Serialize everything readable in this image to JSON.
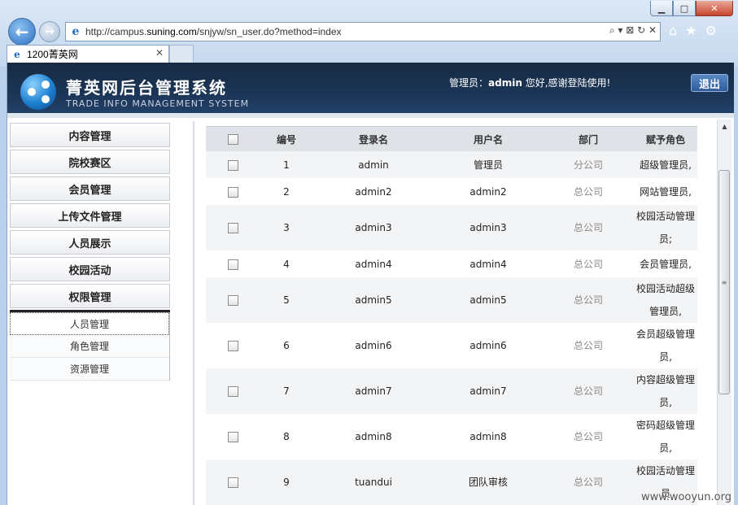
{
  "browser": {
    "url_prefix": "http://campus.",
    "url_domain": "suning.com",
    "url_suffix": "/snjyw/sn_user.do?method=index",
    "tab_title": "1200菁英网",
    "addr_tools": "⌕ ▾ ⊠ ↻ ✕"
  },
  "header": {
    "title_cn": "菁英网后台管理系统",
    "title_en": "TRADE INFO MANAGEMENT SYSTEM",
    "welcome_prefix": "管理员：",
    "welcome_user": "admin",
    "welcome_suffix": " 您好,感谢登陆使用!",
    "logout_label": "退出"
  },
  "sidebar": {
    "menu": [
      "内容管理",
      "院校赛区",
      "会员管理",
      "上传文件管理",
      "人员展示",
      "校园活动",
      "权限管理"
    ],
    "submenu": [
      "人员管理",
      "角色管理",
      "资源管理"
    ]
  },
  "table": {
    "columns": [
      "编号",
      "登录名",
      "用户名",
      "部门",
      "赋予角色"
    ],
    "rows": [
      {
        "id": "1",
        "login": "admin",
        "name": "管理员",
        "dept": "分公司",
        "role": "超级管理员,"
      },
      {
        "id": "2",
        "login": "admin2",
        "name": "admin2",
        "dept": "总公司",
        "role": "网站管理员,"
      },
      {
        "id": "3",
        "login": "admin3",
        "name": "admin3",
        "dept": "总公司",
        "role": "校园活动管理员;"
      },
      {
        "id": "4",
        "login": "admin4",
        "name": "admin4",
        "dept": "总公司",
        "role": "会员管理员,"
      },
      {
        "id": "5",
        "login": "admin5",
        "name": "admin5",
        "dept": "总公司",
        "role": "校园活动超级管理员,"
      },
      {
        "id": "6",
        "login": "admin6",
        "name": "admin6",
        "dept": "总公司",
        "role": "会员超级管理员,"
      },
      {
        "id": "7",
        "login": "admin7",
        "name": "admin7",
        "dept": "总公司",
        "role": "内容超级管理员,"
      },
      {
        "id": "8",
        "login": "admin8",
        "name": "admin8",
        "dept": "总公司",
        "role": "密码超级管理员,"
      },
      {
        "id": "9",
        "login": "tuandui",
        "name": "团队审核",
        "dept": "总公司",
        "role": "校园活动管理员"
      }
    ]
  },
  "watermark": "www.wooyun.org"
}
